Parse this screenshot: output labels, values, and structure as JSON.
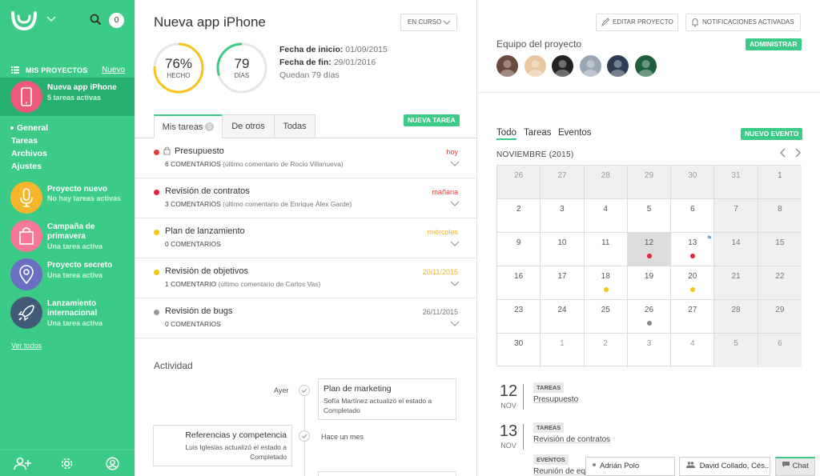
{
  "sidebar": {
    "notification_count": "0",
    "projects_heading": "MIS PROYECTOS",
    "new_link": "Nuevo",
    "projects": [
      {
        "name": "Nueva app iPhone",
        "subtitle": "5 tareas activas",
        "color": "#ee5a7b",
        "icon": "phone-icon"
      },
      {
        "name": "Proyecto nuevo",
        "subtitle": "No hay tareas activas",
        "color": "#f7b52c",
        "icon": "microphone-icon"
      },
      {
        "name": "Campaña de primavera",
        "subtitle": "Una tarea activa",
        "color": "#f6799a",
        "icon": "shopping-bag-icon"
      },
      {
        "name": "Proyecto secreto",
        "subtitle": "Una tarea activa",
        "color": "#6b6fc4",
        "icon": "location-pin-icon"
      },
      {
        "name": "Lanzamiento internacional",
        "subtitle": "Una tarea activa",
        "color": "#415a77",
        "icon": "rocket-icon"
      }
    ],
    "subnav": [
      "General",
      "Tareas",
      "Archivos",
      "Ajustes"
    ],
    "see_all": "Ver todos",
    "accent": "#3bcb86"
  },
  "project": {
    "title": "Nueva app iPhone",
    "status": "EN CURSO",
    "done_pct": "76%",
    "done_label": "HECHO",
    "done_fraction": 0.76,
    "days": "79",
    "days_label": "DÍAS",
    "days_fraction": 0.3,
    "start_label": "Fecha de inicio:",
    "start_value": "01/09/2015",
    "end_label": "Fecha de fin:",
    "end_value": "29/01/2016",
    "remaining": "Quedan 79 días"
  },
  "tasks_tabs": {
    "mine": "Mis tareas",
    "mine_count": "5",
    "others": "De otros",
    "all": "Todas",
    "new_task": "NUEVA TAREA"
  },
  "tasks": [
    {
      "name": "Presupuesto",
      "comments": "6 COMENTARIOS",
      "last": "(último comentario de Rocío Villanueva)",
      "due": "hoy",
      "due_color": "#e23a3a",
      "dot": "#e23a3a",
      "locked": true
    },
    {
      "name": "Revisión de contratos",
      "comments": "3 COMENTARIOS",
      "last": "(último comentario de Enrique Álex Garde)",
      "due": "mañana",
      "due_color": "#e23a3a",
      "dot": "#e8203a",
      "locked": false
    },
    {
      "name": "Plan de lanzamiento",
      "comments": "0 COMENTARIOS",
      "last": "",
      "due": "miércoles",
      "due_color": "#f0b429",
      "dot": "#f5c518",
      "locked": false
    },
    {
      "name": "Revisión de objetivos",
      "comments": "1 COMENTARIO",
      "last": "(último comentario de Carlos Vas)",
      "due": "20/11/2015",
      "due_color": "#f0b429",
      "dot": "#f5c518",
      "locked": false
    },
    {
      "name": "Revisión de bugs",
      "comments": "0 COMENTARIOS",
      "last": "",
      "due": "26/11/2015",
      "due_color": "#777777",
      "dot": "#999999",
      "locked": false
    }
  ],
  "activity": {
    "title": "Actividad",
    "items": [
      {
        "when": "Ayer",
        "title": "Plan de marketing",
        "text": "Sofía Martínez actualizó el estado a Completado"
      },
      {
        "when": "Hace un mes",
        "title": "Referencias y competencia",
        "text": "Luis Iglesias actualizó el estado a Completado"
      }
    ]
  },
  "right": {
    "edit_project": "EDITAR PROYECTO",
    "notifications": "NOTIFICACIONES ACTIVADAS",
    "team_title": "Equipo del proyecto",
    "admin": "ADMINISTRAR",
    "team": [
      "#6b4b3e",
      "#e8c8a0",
      "#222222",
      "#9aa8b5",
      "#2d3b55",
      "#1f5e3a"
    ],
    "cal_tabs": [
      "Todo",
      "Tareas",
      "Eventos"
    ],
    "new_event": "NUEVO EVENTO",
    "month": "NOVIEMBRE (2015)"
  },
  "calendar": {
    "weeks": [
      [
        "26",
        "27",
        "28",
        "29",
        "30",
        "31",
        "1"
      ],
      [
        "2",
        "3",
        "4",
        "5",
        "6",
        "7",
        "8"
      ],
      [
        "9",
        "10",
        "11",
        "12",
        "13",
        "14",
        "15"
      ],
      [
        "16",
        "17",
        "18",
        "19",
        "20",
        "21",
        "22"
      ],
      [
        "23",
        "24",
        "25",
        "26",
        "27",
        "28",
        "29"
      ],
      [
        "30",
        "1",
        "2",
        "3",
        "4",
        "5",
        "6"
      ]
    ],
    "events": {
      "12": "#e8203a",
      "13": "#e8203a",
      "18": "#f5c518",
      "20": "#f5c518",
      "26": "#888888"
    }
  },
  "agenda": [
    {
      "day": "12",
      "mon": "NOV",
      "tag": "TAREAS",
      "text": "Presupuesto"
    },
    {
      "day": "13",
      "mon": "NOV",
      "tag": "TAREAS",
      "text": "Revisión de contratos"
    },
    {
      "day": "",
      "mon": "",
      "tag": "EVENTOS",
      "text": "Reunión de eq"
    }
  ],
  "chat": {
    "box1": "Adrián Polo",
    "box2": "David Collado, Cés...",
    "button": "Chat"
  }
}
